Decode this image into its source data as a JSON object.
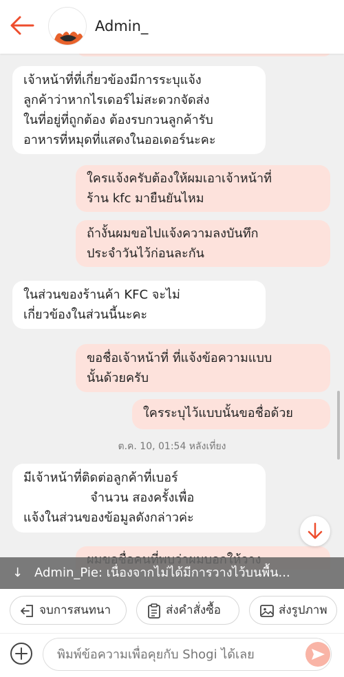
{
  "header": {
    "title": "Admin_",
    "accent": "#ee4d2d"
  },
  "messages": [
    {
      "side": "in",
      "text": "เจ้าหน้าที่ที่เกี่ยวข้องมีการระบุแจ้ง\nลูกค้าว่าหากไรเดอร์ไม่สะดวกจัดส่ง\nในที่อยู่ที่ถูกต้อง ต้องรบกวนลูกค้ารับ\nอาหารที่หมุดที่แสดงในออเดอร์นะคะ"
    },
    {
      "side": "out",
      "text": "ใครแจ้งครับต้องให้ผมเอาเจ้าหน้าที่\nร้าน kfc มายืนยันไหม"
    },
    {
      "side": "out",
      "text": "ถ้างั้นผมขอไปแจ้งความลงบันทึก\nประจำวันไว้ก่อนละกัน"
    },
    {
      "side": "in",
      "text": "ในส่วนของร้านค้า KFC จะไม่\nเกี่ยวข้องในส่วนนี้นะคะ"
    },
    {
      "side": "out",
      "text": "ขอชื่อเจ้าหน้าที่ ที่แจ้งข้อความแบบ\nนั้นด้วยครับ"
    },
    {
      "side": "out",
      "text": "ใครระบุไว้แบบนั้นขอชื่อด้วย"
    },
    {
      "side": "in",
      "text": "มีเจ้าหน้าที่ติดต่อลูกค้าที่เบอร์\n                 จำนวน สองครั้งเพื่อ\nแจ้งในส่วนของข้อมูลดังกล่าวค่ะ"
    },
    {
      "side": "out",
      "text": "ผมขอชื่อคนที่พบว่าผมบอกให้วาง\nสินค้าไหงไว้"
    }
  ],
  "timestamp": "ต.ค. 10, 01:54 หลังเที่ยง",
  "banner": {
    "arrow": "↓",
    "text": "Admin_Pie: เนื่องจากไม่ได้มีการวางไว้บนพื้น..."
  },
  "actions": {
    "end_chat": "จบการสนทนา",
    "send_order": "ส่งคำสั่งซื้อ",
    "send_image": "ส่งรูปภาพ"
  },
  "composer": {
    "placeholder": "พิมพ์ข้อความเพื่อคุยกับ Shogi ได้เลย"
  },
  "icons": {
    "back": "arrow-left-icon",
    "scroll_down": "arrow-down-icon",
    "end_chat": "exit-icon",
    "send_order": "clipboard-icon",
    "send_image": "image-icon",
    "add": "plus-circle-icon",
    "send": "send-icon"
  }
}
